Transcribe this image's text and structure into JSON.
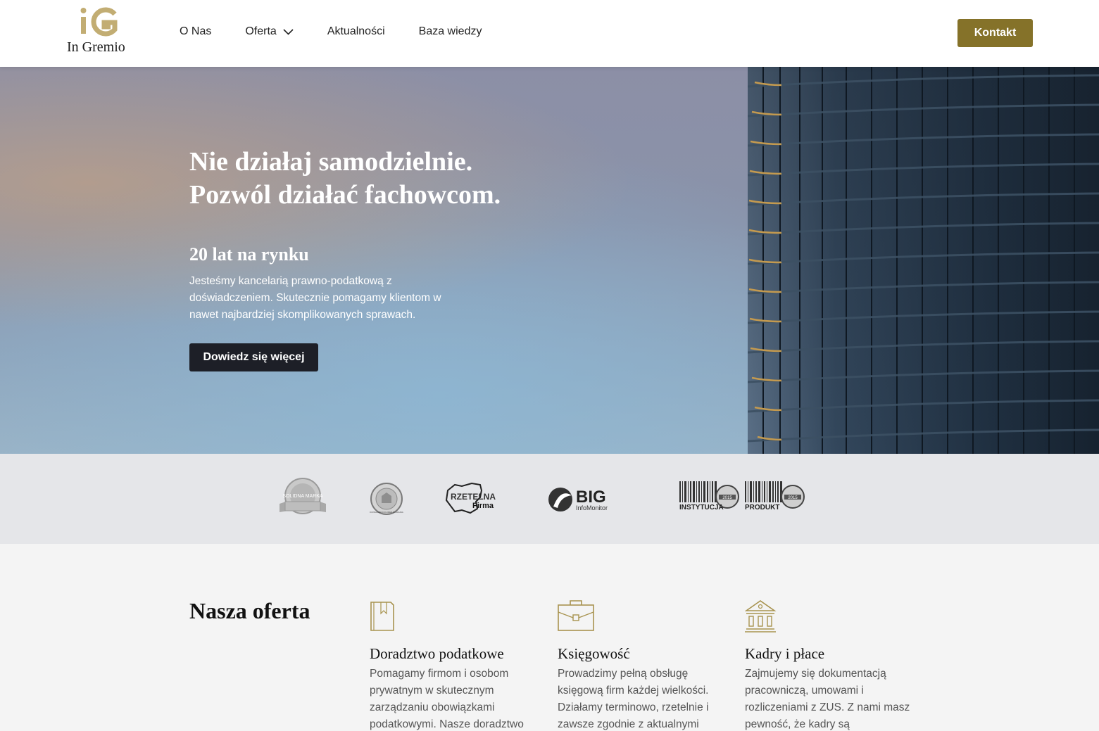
{
  "brand": {
    "name": "In Gremio",
    "mark": "iG",
    "color": "#857229"
  },
  "nav": {
    "items": [
      {
        "label": "O Nas"
      },
      {
        "label": "Oferta",
        "has_dropdown": true
      },
      {
        "label": "Aktualności"
      },
      {
        "label": "Baza wiedzy"
      }
    ],
    "contact_label": "Kontakt"
  },
  "hero": {
    "title_line1": "Nie działaj samodzielnie.",
    "title_line2": "Pozwól działać fachowcom.",
    "subtitle": "20 lat na rynku",
    "text": "Jesteśmy kancelarią prawno-podatkową z doświadczeniem. Skutecznie pomagamy klientom w nawet najbardziej skomplikowanych sprawach.",
    "button_label": "Dowiedz się więcej"
  },
  "badges": {
    "solidna_marka": "SOLIDNA MARKA",
    "konsument": "KONSUMENCKI LIDER ZAUFANIA",
    "rzetelna_1": "RZETELNA",
    "rzetelna_2": "Firma",
    "big_1": "BIG",
    "big_2": "InfoMonitor",
    "instytucja": "INSTYTUCJA",
    "produkt": "PRODUKT",
    "year": "2015"
  },
  "offer": {
    "title": "Nasza oferta",
    "cards": [
      {
        "icon": "book-icon",
        "title": "Doradztwo podatkowe",
        "text": "Pomagamy firmom i osobom prywatnym w skutecznym zarządzaniu obowiązkami podatkowymi. Nasze doradztwo"
      },
      {
        "icon": "briefcase-icon",
        "title": "Księgowość",
        "text": "Prowadzimy pełną obsługę księgową firm każdej wielkości. Działamy terminowo, rzetelnie i zawsze zgodnie z aktualnymi"
      },
      {
        "icon": "institution-icon",
        "title": "Kadry i płace",
        "text": "Zajmujemy się dokumentacją pracowniczą, umowami i rozliczeniami z ZUS. Z nami masz pewność, że kadry są"
      }
    ]
  }
}
